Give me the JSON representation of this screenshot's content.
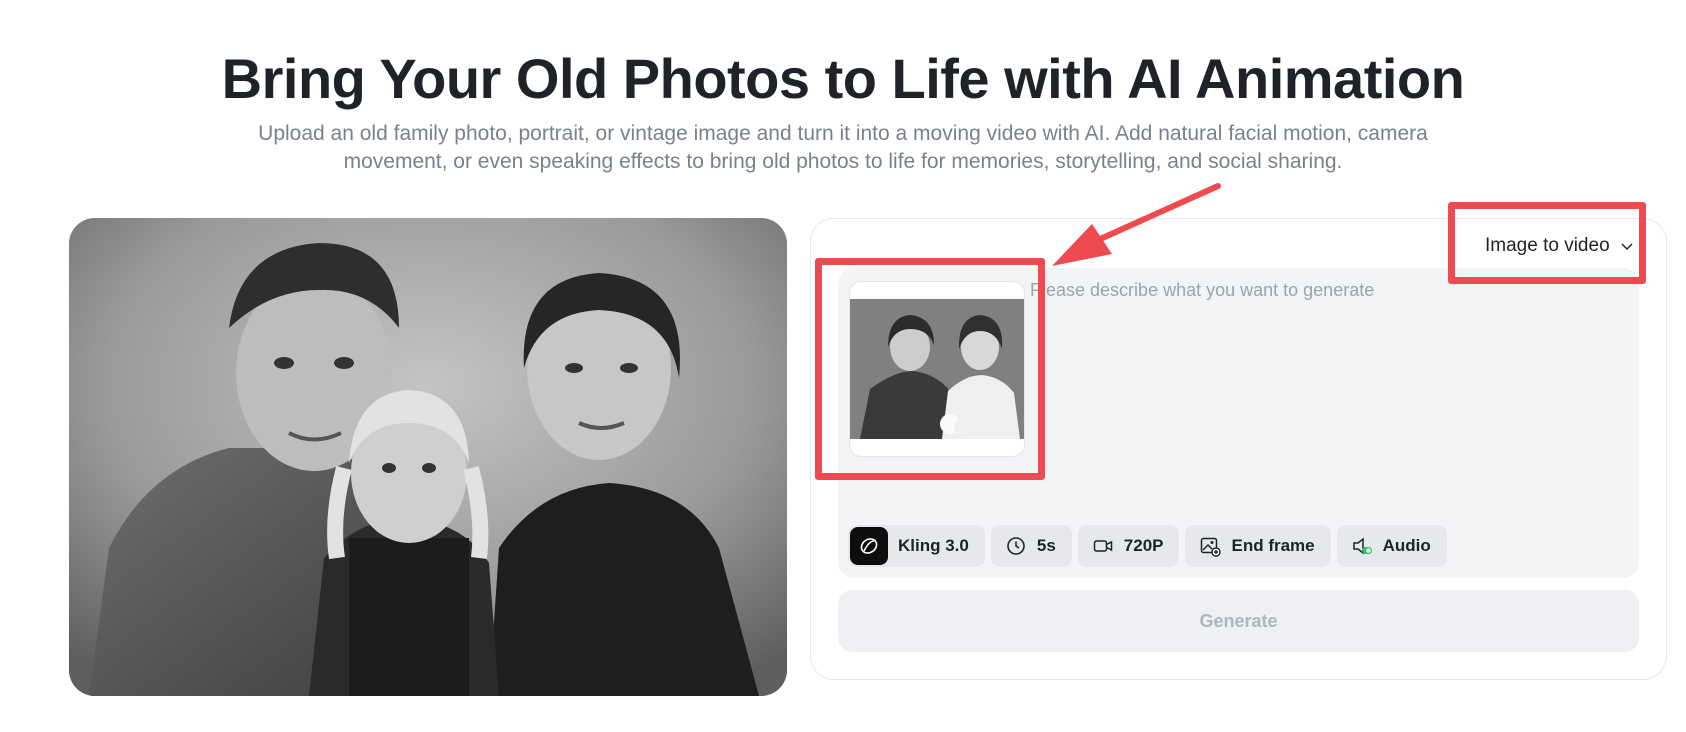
{
  "header": {
    "title": "Bring Your Old Photos to Life with AI Animation",
    "subtitle_line1": "Upload an old family photo, portrait, or vintage image and turn it into a moving video with AI. Add natural facial motion, camera",
    "subtitle_line2": "movement, or even speaking effects to bring old photos to life for memories, storytelling, and social sharing."
  },
  "preview": {
    "image_description": "black-and-white vintage family portrait",
    "icon": "family-photo"
  },
  "generator": {
    "mode": {
      "label": "Image to video",
      "icon": "chevron-down-icon"
    },
    "uploaded_image": {
      "icon": "portrait-thumbnail"
    },
    "prompt": {
      "value": "",
      "placeholder": "Please describe what you want to generate"
    },
    "options": {
      "model": {
        "label": "Kling 3.0",
        "icon": "kling-logo-icon"
      },
      "duration": {
        "label": "5s",
        "icon": "clock-icon"
      },
      "resolution": {
        "label": "720P",
        "icon": "video-camera-icon"
      },
      "end_frame": {
        "label": "End frame",
        "icon": "image-add-icon"
      },
      "audio": {
        "label": "Audio",
        "icon": "speaker-toggle-icon"
      }
    },
    "generate_label": "Generate"
  },
  "annotations": {
    "highlight_color": "#ef4a50"
  },
  "colors": {
    "heading": "#1f2328",
    "subtitle": "#7b818c",
    "composer_bg": "#f3f4f6",
    "chip_bg": "#e7e8eb",
    "generate_disabled_text": "#b1b5bd"
  }
}
